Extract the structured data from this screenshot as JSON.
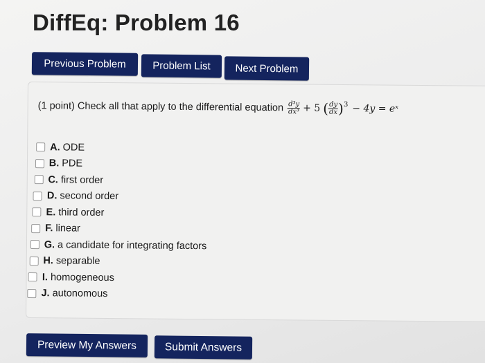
{
  "page": {
    "title": "DiffEq: Problem 16"
  },
  "nav": {
    "previous": "Previous Problem",
    "list": "Problem List",
    "next": "Next Problem"
  },
  "problem": {
    "prompt": "(1 point) Check all that apply to the differential equation",
    "equation": {
      "d3_num": "d³y",
      "d3_den": "dx³",
      "plus5": "+ 5",
      "dy_num": "dy",
      "dy_den": "dx",
      "power": "3",
      "rest": "− 4y = eˣ"
    },
    "options": [
      {
        "letter": "A.",
        "text": "ODE"
      },
      {
        "letter": "B.",
        "text": "PDE"
      },
      {
        "letter": "C.",
        "text": "first order"
      },
      {
        "letter": "D.",
        "text": "second order"
      },
      {
        "letter": "E.",
        "text": "third order"
      },
      {
        "letter": "F.",
        "text": "linear"
      },
      {
        "letter": "G.",
        "text": "a candidate for integrating factors"
      },
      {
        "letter": "H.",
        "text": "separable"
      },
      {
        "letter": "I.",
        "text": "homogeneous"
      },
      {
        "letter": "J.",
        "text": "autonomous"
      }
    ]
  },
  "actions": {
    "preview": "Preview My Answers",
    "submit": "Submit Answers"
  },
  "colors": {
    "button": "#14245e",
    "panel": "#f1f1f0"
  }
}
